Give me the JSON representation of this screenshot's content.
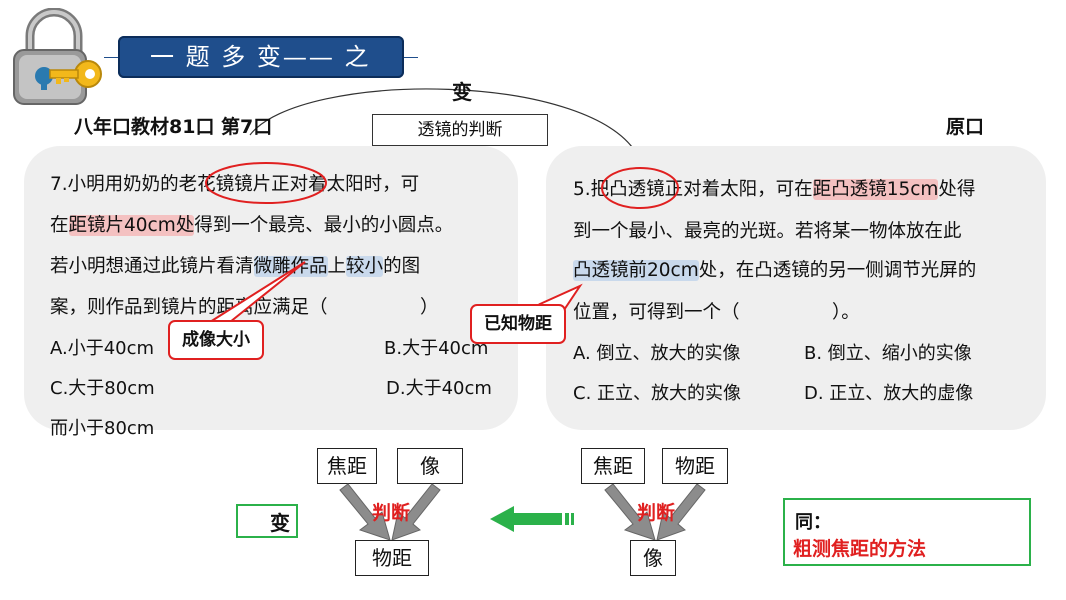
{
  "banner": {
    "title": "一 题 多 变—— 之"
  },
  "header": {
    "left_source": "八年口教材81口 第7口",
    "center_change": "变",
    "topic_box": "透镜的判断",
    "right_source": "原口"
  },
  "left_question": {
    "line1": [
      "7.小明用奶奶的",
      "老花镜镜片",
      "正对着太阳时，可"
    ],
    "line2": [
      "在",
      "距镜片40cm处",
      "得到一个最亮、最小的小圆点。"
    ],
    "line3": [
      "若小明想通过此镜片看清",
      "微雕作品",
      "上",
      "较小",
      "的图"
    ],
    "line4": "案，则作品到镜片的距离应满足（　　　　　）",
    "options": {
      "a": "A.小于40cm",
      "b": "B.大于40cm",
      "c": "C.大于80cm",
      "d": "D.大于40cm",
      "d_cont": "而小于80cm"
    },
    "callout_image": "成像大小"
  },
  "right_question": {
    "line1": [
      "5.把",
      "凸透镜",
      "正对着太阳，可在",
      "距凸透镜15cm",
      "处得"
    ],
    "line2": "到一个最小、最亮的光斑。若将某一物体放在此",
    "line3": [
      "凸透镜前20cm",
      "处，在凸透镜的另一侧调节光屏的"
    ],
    "line4": "位置，可得到一个（　　　　　）。",
    "options": {
      "a": "A. 倒立、放大的实像",
      "b": "B. 倒立、缩小的实像",
      "c": "C. 正立、放大的实像",
      "d": "D. 正立、放大的虚像"
    },
    "callout_known": "已知物距"
  },
  "diagram_left": {
    "box1": "焦距",
    "box2": "像",
    "judge": "判断",
    "result": "物距",
    "change": "变"
  },
  "diagram_right": {
    "box1": "焦距",
    "box2": "物距",
    "judge": "判断",
    "result": "像"
  },
  "same_box": {
    "label": "同：",
    "method": "粗测焦距的方法"
  },
  "colors": {
    "banner": "#1f4e8c",
    "red_highlight": "#f4c1c1",
    "blue_highlight": "#c9d9ec",
    "panel": "#efefef",
    "green": "#2bb14a",
    "red": "#e02020"
  }
}
